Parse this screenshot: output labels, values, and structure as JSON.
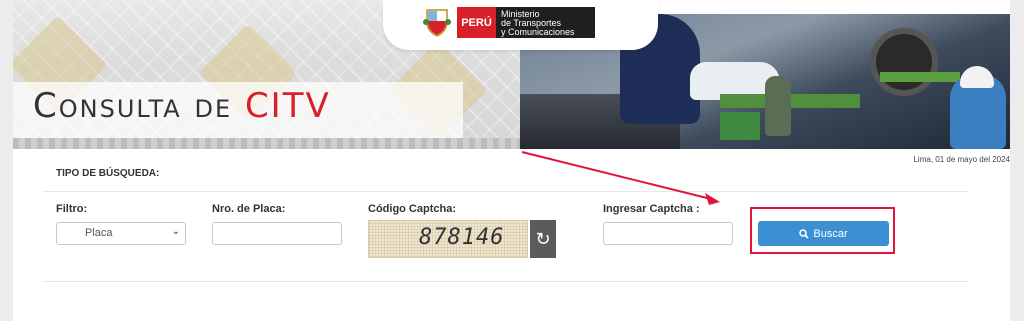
{
  "header": {
    "peru_label": "PERÚ",
    "ministry_line1": "Ministerio",
    "ministry_line2": "de Transportes",
    "ministry_line3": "y Comunicaciones"
  },
  "banner": {
    "title_main": "Consulta de ",
    "title_accent": "CITV"
  },
  "date": "Lima, 01 de mayo del 2024",
  "search_type_label": "TIPO DE BÚSQUEDA:",
  "form": {
    "filtro_label": "Filtro:",
    "filtro_value": "Placa",
    "placa_label": "Nro. de Placa:",
    "placa_value": "",
    "captcha_label": "Código Captcha:",
    "captcha_code": "878146",
    "ingresar_label": "Ingresar Captcha :",
    "ingresar_value": "",
    "buscar_label": "Buscar"
  },
  "colors": {
    "accent_red": "#d7202a",
    "button_blue": "#3c8fd0",
    "highlight_red": "#e0143c"
  }
}
